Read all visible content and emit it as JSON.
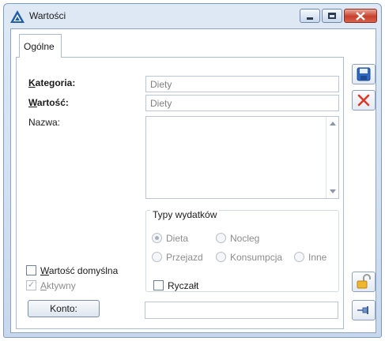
{
  "window": {
    "title": "Wartości",
    "logo_icon": "comarch-triangle-icon",
    "minimize_icon": "minimize-icon",
    "maximize_icon": "restore-icon",
    "close_icon": "close-icon"
  },
  "tabs": [
    {
      "label": "Ogólne",
      "active": true
    }
  ],
  "form": {
    "kategoria_label": "Kategoria:",
    "kategoria_value": "Diety",
    "wartosc_label": "Wartość:",
    "wartosc_value": "Diety",
    "nazwa_label": "Nazwa:",
    "nazwa_value": "",
    "expense_group_title": "Typy wydatków",
    "expense_types": [
      {
        "label": "Dieta",
        "selected": true
      },
      {
        "label": "Nocleg",
        "selected": false
      },
      {
        "label": "Przejazd",
        "selected": false
      },
      {
        "label": "Konsumpcja",
        "selected": false
      },
      {
        "label": "Inne",
        "selected": false
      }
    ],
    "ryczalt_label": "Ryczałt",
    "ryczalt_checked": false,
    "default_value_label": "Wartość domyślna",
    "default_value_checked": false,
    "active_label": "Aktywny",
    "active_checked": true,
    "konto_button": "Konto:",
    "konto_value": ""
  },
  "side_buttons": {
    "save_icon": "save-icon",
    "cancel_icon": "cancel-x-icon",
    "lock_icon": "unlock-icon",
    "pin_icon": "pin-icon"
  },
  "colors": {
    "title_bar": "#c7d8ee",
    "close_button": "#c7402c",
    "cancel_x": "#d93a2b",
    "border": "#a9bcd3"
  }
}
